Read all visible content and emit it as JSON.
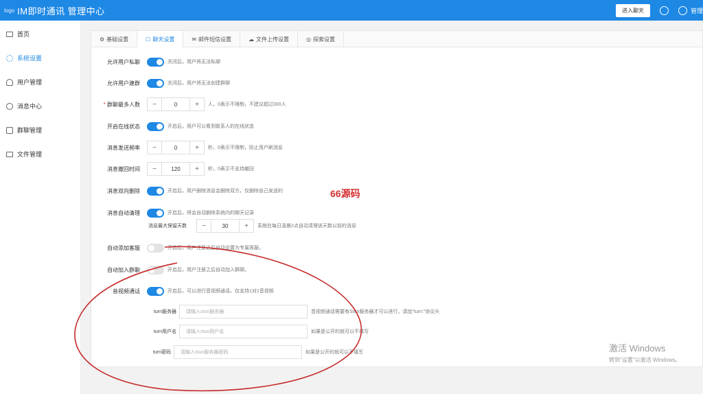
{
  "header": {
    "logo_text": "logo",
    "title": "IM即时通讯 管理中心",
    "enter_chat_label": "进入聊天",
    "admin_label": "管理"
  },
  "sidebar": {
    "items": [
      {
        "label": "首页",
        "icon": "monitor-icon"
      },
      {
        "label": "系统设置",
        "icon": "gear-icon"
      },
      {
        "label": "用户管理",
        "icon": "user-icon"
      },
      {
        "label": "消息中心",
        "icon": "message-icon"
      },
      {
        "label": "群聊管理",
        "icon": "chat-icon"
      },
      {
        "label": "文件管理",
        "icon": "folder-icon"
      }
    ]
  },
  "tabs": [
    {
      "label": "基础设置",
      "icon": "⚙"
    },
    {
      "label": "聊天设置",
      "icon": "☐"
    },
    {
      "label": "邮件短信设置",
      "icon": "✉"
    },
    {
      "label": "文件上传设置",
      "icon": "☁"
    },
    {
      "label": "探索设置",
      "icon": "◎"
    }
  ],
  "settings": {
    "private_chat": {
      "label": "允许用户私聊",
      "hint": "关闭后，用户将无法私聊"
    },
    "create_group": {
      "label": "允许用户建群",
      "hint": "关闭后，用户将无法创建群聊"
    },
    "group_max": {
      "label": "群聊最多人数",
      "value": "0",
      "hint": "人，0表示不限制，不建议超过300人"
    },
    "online_status": {
      "label": "开启在线状态",
      "hint": "开启后，用户可以看到联系人的在线状态"
    },
    "send_rate": {
      "label": "消息发送频率",
      "value": "0",
      "hint": "秒，0表示不限制，防止用户刷消息"
    },
    "recall_time": {
      "label": "消息撤回时间",
      "value": "120",
      "hint": "秒，0表示不支持撤回"
    },
    "two_way_delete": {
      "label": "消息双向删除",
      "hint": "开启后，用户删除消息会删除双方，仅删除自己发送的"
    },
    "auto_clean": {
      "label": "消息自动清理",
      "hint": "开启后，将会自动删除系统内的聊天记录"
    },
    "keep_days": {
      "label": "消息最大保留天数",
      "value": "30",
      "hint": "系统在每日凌晨2点自动清理该天数以前的消息"
    },
    "auto_friend": {
      "label": "自动添加客服",
      "hint": "开启后，用户注册之后自动设置为专属客服。"
    },
    "auto_group": {
      "label": "自动加入群聊",
      "hint": "开启后，用户注册之后自动加入群聊。"
    },
    "av_call": {
      "label": "音视频通话",
      "hint": "开启后，可以进行音视频通话，仅支持1对1音视频"
    },
    "turn_server": {
      "label": "turn服务器",
      "placeholder": "请输入stun服务器",
      "hint": "音视频通话需要有Stun服务器才可以进行，请加\"turn:\"协议头"
    },
    "turn_user": {
      "label": "turn用户名",
      "placeholder": "请输入stun用户名",
      "hint": "如果是公开的就可以不填写"
    },
    "turn_pass": {
      "label": "turn密码",
      "placeholder": "请输入stun服务器密码",
      "hint": "如果是公开的就可以不填写"
    }
  },
  "stepper_minus": "−",
  "stepper_plus": "+",
  "watermark": "66源码",
  "windows_activation": {
    "line1": "激活 Windows",
    "line2": "转到\"设置\"以激活 Windows。"
  }
}
